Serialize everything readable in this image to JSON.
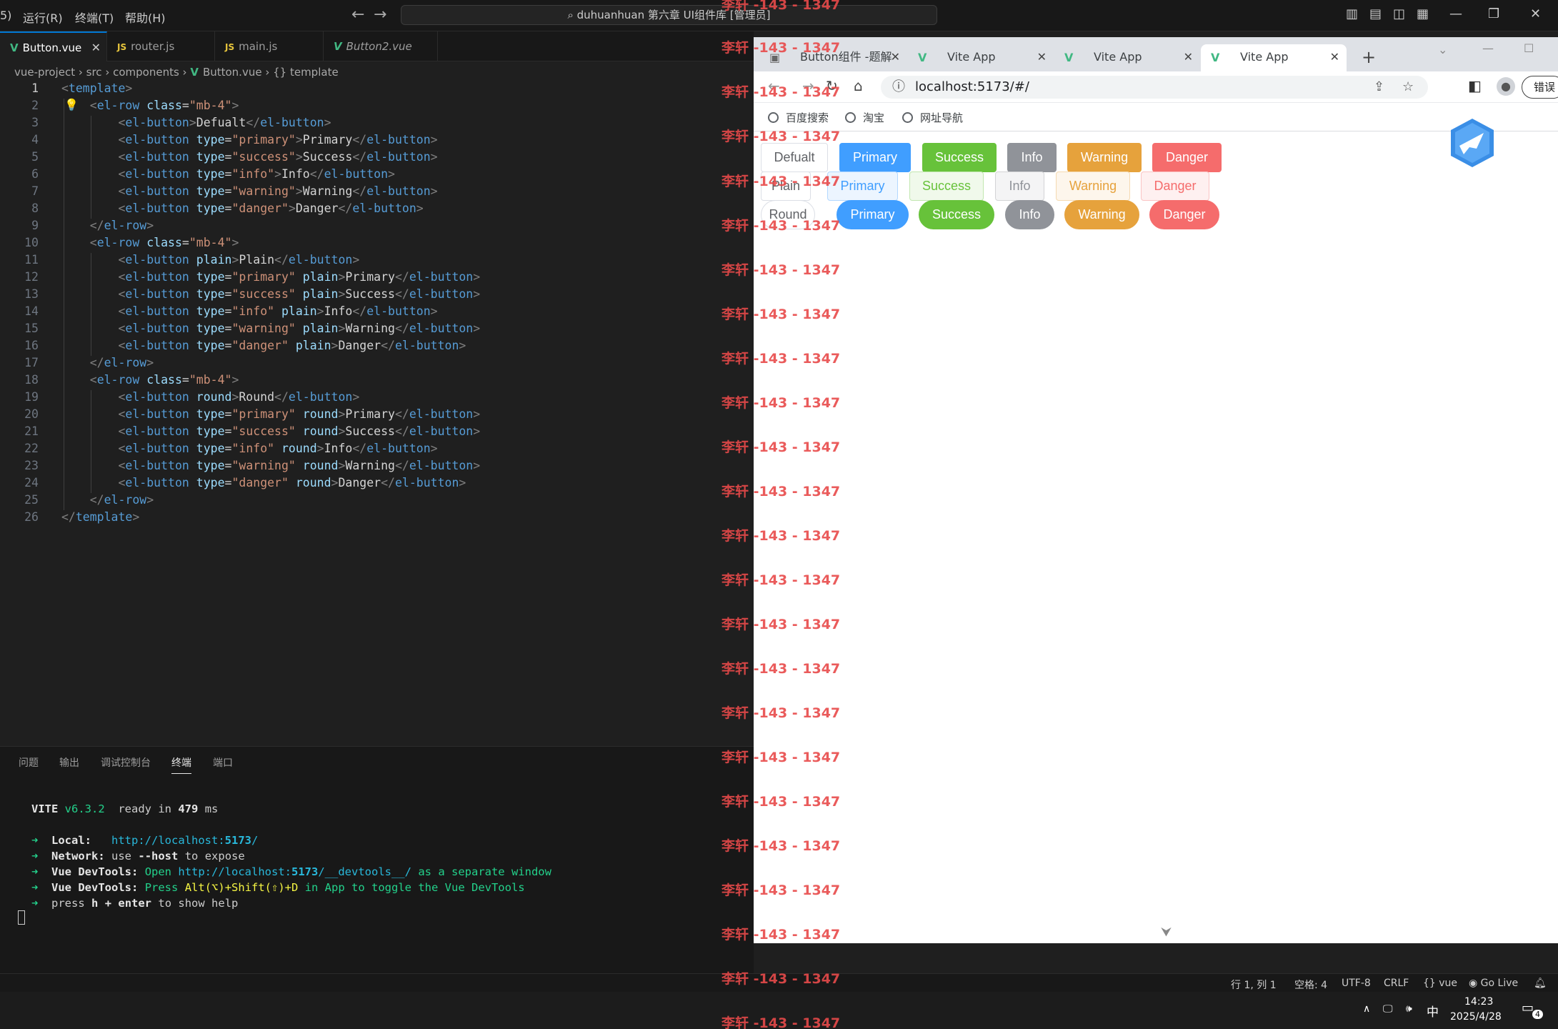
{
  "menu": [
    "5)",
    "运行(R)",
    "终端(T)",
    "帮助(H)"
  ],
  "command_center": "duhuanhuan 第六章 UI组件库 [管理员]",
  "editor_tabs": [
    {
      "label": "Button.vue",
      "kind": "vue"
    },
    {
      "label": "router.js",
      "kind": "js"
    },
    {
      "label": "main.js",
      "kind": "js"
    },
    {
      "label": "Button2.vue",
      "kind": "vue"
    }
  ],
  "breadcrumb": [
    "vue-project",
    "src",
    "components",
    "Button.vue",
    "{} template"
  ],
  "code_lines": [
    "1",
    "2",
    "3",
    "4",
    "5",
    "6",
    "7",
    "8",
    "9",
    "10",
    "11",
    "12",
    "13",
    "14",
    "15",
    "16",
    "17",
    "18",
    "19",
    "20",
    "21",
    "22",
    "23",
    "24",
    "25",
    "26"
  ],
  "panel_tabs": [
    "问题",
    "输出",
    "调试控制台",
    "终端",
    "端口"
  ],
  "terminal": {
    "vite_name": "VITE",
    "vite_version": "v6.3.2",
    "ready": "ready in",
    "ms_value": "479",
    "ms_unit": "ms",
    "local_label": "Local:",
    "local_url_a": "http://localhost:",
    "local_url_port": "5173",
    "local_url_b": "/",
    "network_label": "Network:",
    "network_a": "use",
    "network_flag": "--host",
    "network_b": "to expose",
    "dev1_label": "Vue DevTools:",
    "dev1_a": "Open",
    "dev1_url_a": "http://localhost:",
    "dev1_url_port": "5173",
    "dev1_url_b": "/__devtools__/",
    "dev1_b": "as a separate window",
    "dev2_label": "Vue DevTools:",
    "dev2_a": "Press",
    "dev2_keys": "Alt(⌥)+Shift(⇧)+D",
    "dev2_b": "in App to toggle the Vue DevTools",
    "help_a": "press",
    "help_keys": "h + enter",
    "help_b": "to show help",
    "arrow": "➜"
  },
  "status": {
    "position": "行 1, 列 1",
    "spaces": "空格: 4",
    "encoding": "UTF-8",
    "eol": "CRLF",
    "lang": "vue",
    "golive": "Go Live"
  },
  "taskbar": {
    "time": "14:23",
    "date": "2025/4/28",
    "ime": "中",
    "notif": "4"
  },
  "browser": {
    "tabs": [
      {
        "label": "Button组件 -题解"
      },
      {
        "label": "Vite App"
      },
      {
        "label": "Vite App"
      },
      {
        "label": "Vite App"
      }
    ],
    "url": "localhost:5173/#/",
    "error_btn": "错误",
    "bookmarks": [
      "百度搜索",
      "淘宝",
      "网址导航"
    ]
  },
  "buttons": {
    "row1": [
      "Defualt",
      "Primary",
      "Success",
      "Info",
      "Warning",
      "Danger"
    ],
    "row2": [
      "Plain",
      "Primary",
      "Success",
      "Info",
      "Warning",
      "Danger"
    ],
    "row3": [
      "Round",
      "Primary",
      "Success",
      "Info",
      "Warning",
      "Danger"
    ]
  },
  "watermark": "李轩 -143 - 1347",
  "colors": {
    "primary": "#409eff",
    "success": "#67c23a",
    "info": "#909399",
    "warning": "#e6a23c",
    "danger": "#f56c6c",
    "watermark": "#e84a4a",
    "accent": "#0078d4"
  }
}
